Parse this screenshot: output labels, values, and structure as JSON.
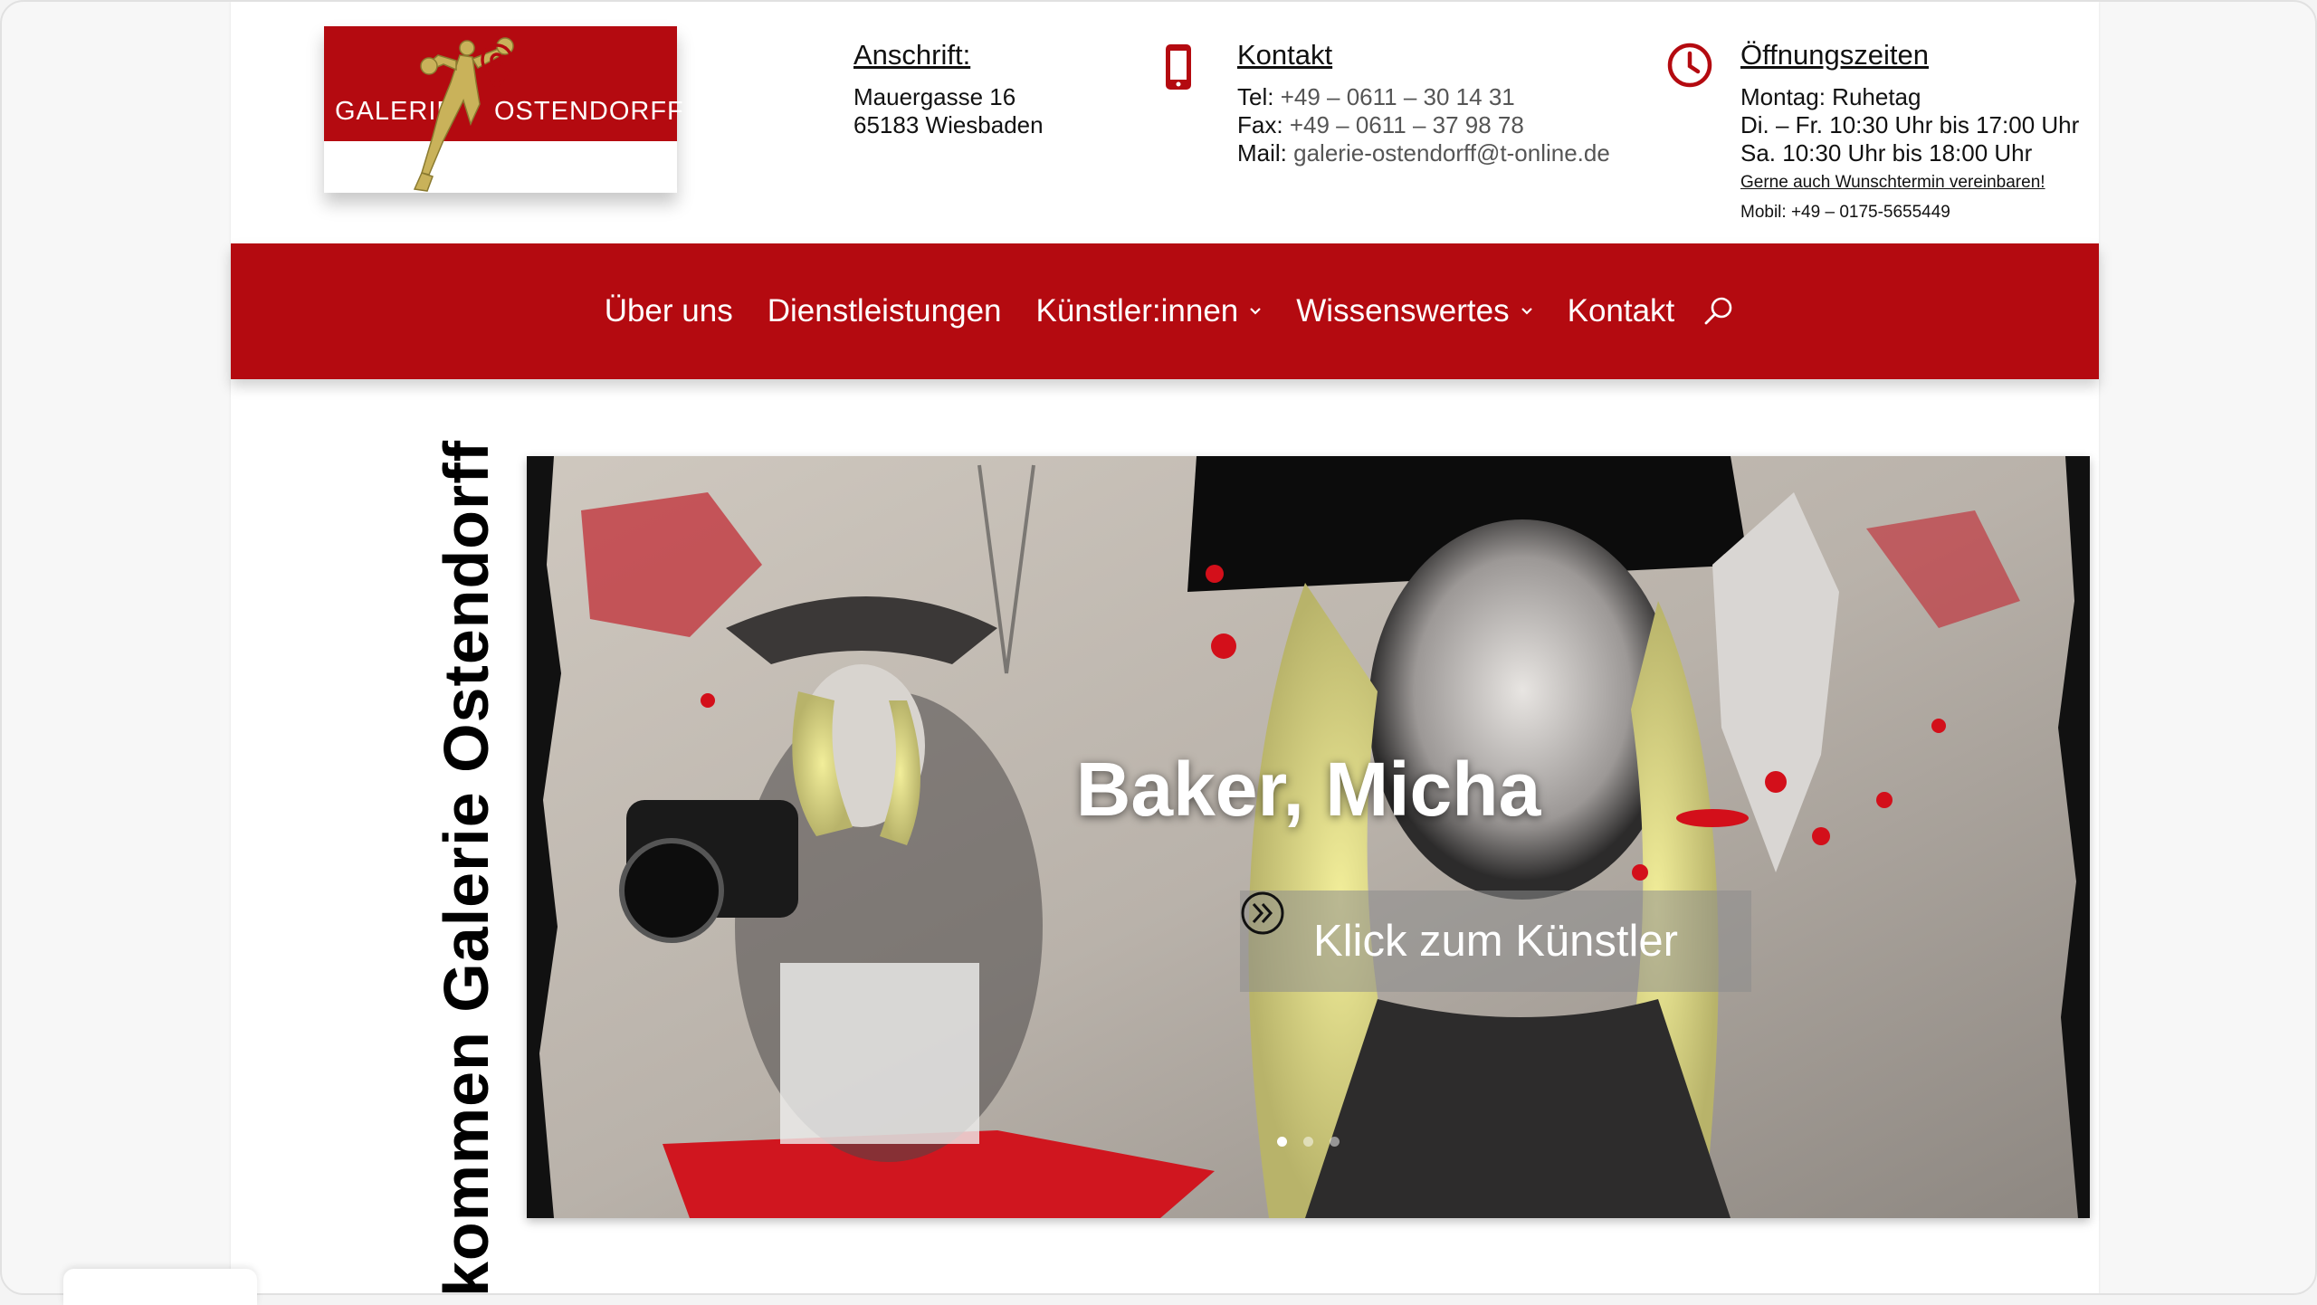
{
  "logo": {
    "text_left": "GALERIE",
    "text_right": "OSTENDORFF"
  },
  "address": {
    "icon": "map-pin-icon",
    "heading": "Anschrift:",
    "line1": "Mauergasse 16",
    "line2": "65183 Wiesbaden"
  },
  "contact": {
    "icon": "smartphone-icon",
    "heading": "Kontakt",
    "tel_label": "Tel:",
    "tel": "+49 – 0611 – 30 14 31",
    "fax_label": "Fax:",
    "fax": "+49 – 0611 – 37 98 78",
    "mail_label": "Mail:",
    "mail": "galerie-ostendorff@t-online.de"
  },
  "hours": {
    "icon": "clock-icon",
    "heading": "Öffnungszeiten",
    "line1": "Montag: Ruhetag",
    "line2": "Di. – Fr. 10:30 Uhr bis 17:00 Uhr",
    "line3": "Sa. 10:30 Uhr bis 18:00 Uhr",
    "appointment": "Gerne auch Wunschtermin vereinbaren!",
    "mobile": "Mobil: +49 – 0175-5655449"
  },
  "nav": {
    "items": [
      {
        "label": "Über uns"
      },
      {
        "label": "Dienstleistungen"
      },
      {
        "label": "Künstler:innen"
      },
      {
        "label": "Wissenswertes"
      },
      {
        "label": "Kontakt"
      }
    ],
    "search_icon": "search-icon"
  },
  "vertical_title": "kommen Galerie Ostendorff",
  "slider": {
    "title": "Baker, Micha",
    "button_label": "Klick zum Künstler",
    "button_icon": "double-chevron-right-icon",
    "active_dot": 1
  },
  "colors": {
    "brand_red": "#b40a10"
  }
}
